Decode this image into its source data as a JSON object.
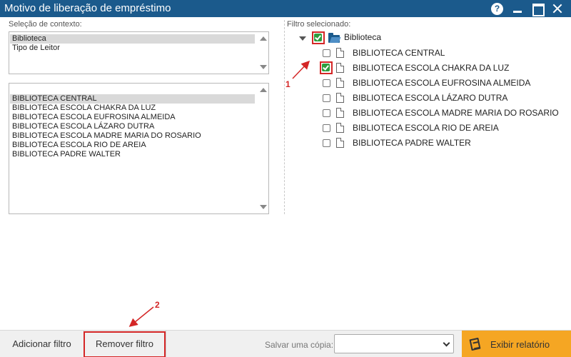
{
  "window": {
    "title": "Motivo de liberação de empréstimo",
    "help_label": "?"
  },
  "context": {
    "label": "Seleção de contexto:",
    "items": [
      "Biblioteca",
      "Tipo de Leitor"
    ],
    "selected": "Biblioteca"
  },
  "values_list": {
    "items": [
      "BIBLIOTECA CENTRAL",
      "BIBLIOTECA ESCOLA CHAKRA DA LUZ",
      "BIBLIOTECA ESCOLA EUFROSINA ALMEIDA",
      "BIBLIOTECA ESCOLA LÁZARO DUTRA",
      "BIBLIOTECA ESCOLA MADRE MARIA DO ROSARIO",
      "BIBLIOTECA ESCOLA RIO DE AREIA",
      "BIBLIOTECA PADRE WALTER"
    ],
    "selected": "BIBLIOTECA CENTRAL"
  },
  "filter": {
    "label": "Filtro selecionado:",
    "root": {
      "label": "Biblioteca",
      "checked": true
    },
    "children": [
      {
        "label": "BIBLIOTECA CENTRAL",
        "checked": false
      },
      {
        "label": "BIBLIOTECA ESCOLA CHAKRA DA LUZ",
        "checked": true
      },
      {
        "label": "BIBLIOTECA ESCOLA EUFROSINA ALMEIDA",
        "checked": false
      },
      {
        "label": "BIBLIOTECA ESCOLA LÁZARO DUTRA",
        "checked": false
      },
      {
        "label": "BIBLIOTECA ESCOLA MADRE MARIA DO ROSARIO",
        "checked": false
      },
      {
        "label": "BIBLIOTECA ESCOLA RIO DE AREIA",
        "checked": false
      },
      {
        "label": "BIBLIOTECA PADRE WALTER",
        "checked": false
      }
    ]
  },
  "annotations": {
    "marker1": "1",
    "marker2": "2",
    "color": "#d42626"
  },
  "footer": {
    "add_filter": "Adicionar filtro",
    "remove_filter": "Remover filtro",
    "save_copy_label": "Salvar uma cópia:",
    "save_copy_value": "",
    "report_button": "Exibir relatório"
  },
  "colors": {
    "titlebar": "#1b5a8c",
    "accent": "#f5a623",
    "check": "#2e9e3e"
  }
}
